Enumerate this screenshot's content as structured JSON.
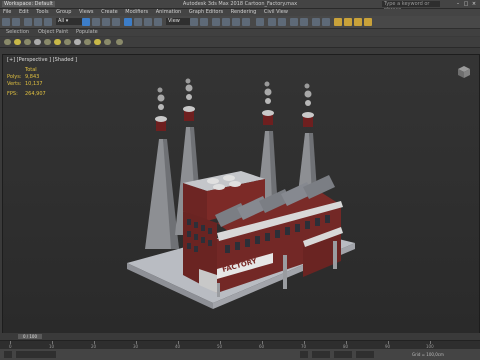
{
  "titlebar": {
    "workspace": "Workspace: Default",
    "title": "Autodesk 3ds Max 2018    Cartoon_Factory.max",
    "search_placeholder": "Type a keyword or phrase"
  },
  "menu": [
    "File",
    "Edit",
    "Tools",
    "Group",
    "Views",
    "Create",
    "Modifiers",
    "Animation",
    "Graph Editors",
    "Rendering",
    "Civil View"
  ],
  "toolbar": {
    "view_dropdown": "View"
  },
  "ribbon": {
    "selection": "Selection",
    "object_paint": "Object Paint",
    "populate": "Populate"
  },
  "viewport": {
    "label": "[+] [Perspective ] [Shaded ]",
    "stats": {
      "header": "Total",
      "polys_label": "Polys:",
      "polys_value": "9,843",
      "verts_label": "Verts:",
      "verts_value": "10,137",
      "fps_label": "FPS:",
      "fps_value": "264,907"
    },
    "sign_text": "FACTORY"
  },
  "timebar": {
    "frame_range": "0 / 100"
  },
  "timeline_ticks": [
    "0",
    "10",
    "20",
    "30",
    "40",
    "50",
    "60",
    "70",
    "80",
    "90",
    "100"
  ],
  "statusbar": {
    "grid": "Grid = 100,0cm"
  }
}
